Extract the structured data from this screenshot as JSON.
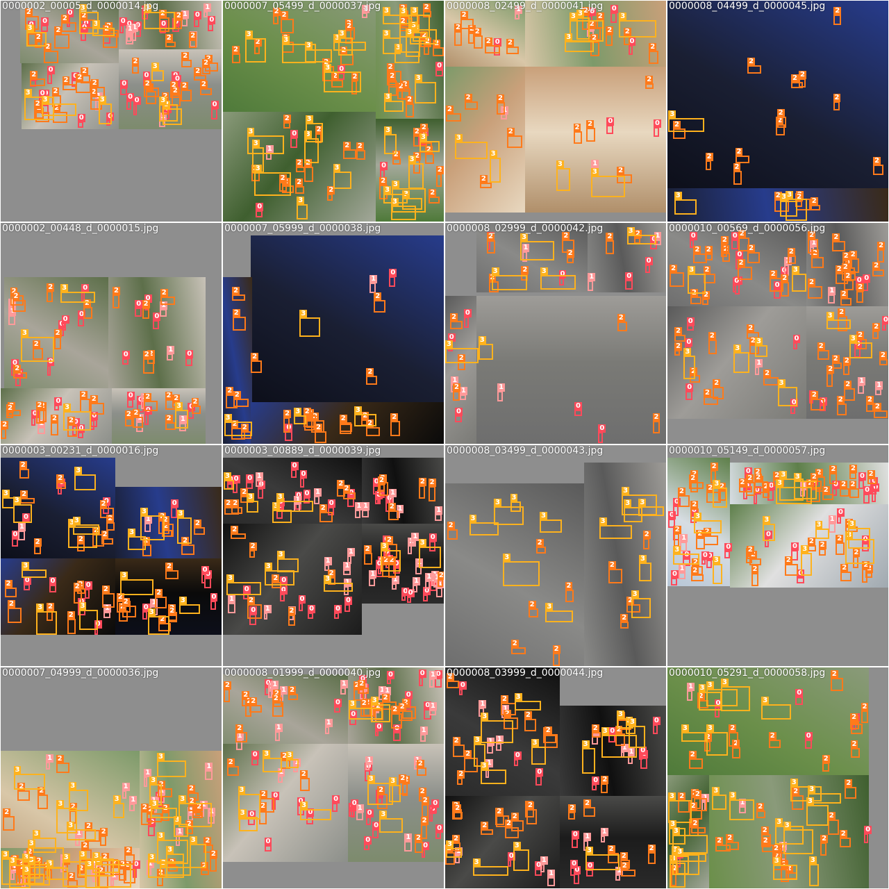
{
  "title": "",
  "class_colors": {
    "0": "#ff4a5a",
    "1": "#ff9a9a",
    "2": "#ff7a1a",
    "3": "#ffb21d"
  },
  "scene_palettes": {
    "city_day": [
      "#7d8b6d",
      "#a9a59a",
      "#5d6f4a",
      "#c8c2b8",
      "#8c8f8a"
    ],
    "green_park": [
      "#4f7a3a",
      "#6b8f4a",
      "#8a9a7a",
      "#3f5f2f",
      "#a3a89a"
    ],
    "road_grey": [
      "#6e6e6e",
      "#8a8a88",
      "#5a5a5a",
      "#9e9c98",
      "#7a7a76"
    ],
    "night": [
      "#0d0f1a",
      "#1a1f33",
      "#273c8c",
      "#3a2a18",
      "#0a0a0a"
    ],
    "warm_town": [
      "#b08f6a",
      "#d9c7a8",
      "#7d9a6a",
      "#c9a07a",
      "#e8d8c0"
    ],
    "sky_city": [
      "#b7c6d6",
      "#d7dde3",
      "#5e7f4a",
      "#e0e0e0",
      "#a0a9b0"
    ],
    "dark_road": [
      "#2a2a2a",
      "#3a3a3a",
      "#101010",
      "#4a4a48",
      "#1c1c1c"
    ]
  },
  "cells": [
    {
      "filename": "0000002_00005_d_0000014.jpg",
      "scene": "city_day",
      "counts": {
        "0": 30,
        "1": 8,
        "2": 35,
        "3": 10
      }
    },
    {
      "filename": "0000007_05499_d_0000037.jpg",
      "scene": "green_park",
      "counts": {
        "0": 8,
        "1": 2,
        "2": 45,
        "3": 30
      }
    },
    {
      "filename": "0000008_02499_d_0000041.jpg",
      "scene": "warm_town",
      "counts": {
        "0": 6,
        "1": 4,
        "2": 22,
        "3": 8
      }
    },
    {
      "filename": "0000008_04499_d_0000045.jpg",
      "scene": "night",
      "counts": {
        "0": 0,
        "1": 0,
        "2": 16,
        "3": 4
      }
    },
    {
      "filename": "0000002_00448_d_0000015.jpg",
      "scene": "city_day",
      "counts": {
        "0": 22,
        "1": 8,
        "2": 28,
        "3": 4
      }
    },
    {
      "filename": "0000007_05999_d_0000038.jpg",
      "scene": "night",
      "counts": {
        "0": 2,
        "1": 1,
        "2": 20,
        "3": 4
      }
    },
    {
      "filename": "0000008_02999_d_0000042.jpg",
      "scene": "road_grey",
      "counts": {
        "0": 10,
        "1": 6,
        "2": 12,
        "3": 6
      }
    },
    {
      "filename": "0000010_00569_d_0000056.jpg",
      "scene": "road_grey",
      "counts": {
        "0": 18,
        "1": 6,
        "2": 50,
        "3": 8
      }
    },
    {
      "filename": "0000003_00231_d_0000016.jpg",
      "scene": "night",
      "counts": {
        "0": 14,
        "1": 4,
        "2": 30,
        "3": 14
      }
    },
    {
      "filename": "0000003_00889_d_0000039.jpg",
      "scene": "dark_road",
      "counts": {
        "0": 35,
        "1": 25,
        "2": 22,
        "3": 10
      }
    },
    {
      "filename": "0000008_03499_d_0000043.jpg",
      "scene": "road_grey",
      "counts": {
        "0": 0,
        "1": 0,
        "2": 10,
        "3": 12
      }
    },
    {
      "filename": "0000010_05149_d_0000057.jpg",
      "scene": "sky_city",
      "counts": {
        "0": 25,
        "1": 4,
        "2": 40,
        "3": 12
      }
    },
    {
      "filename": "0000007_04999_d_0000036.jpg",
      "scene": "warm_town",
      "counts": {
        "0": 4,
        "1": 22,
        "2": 40,
        "3": 28
      }
    },
    {
      "filename": "0000008_01999_d_0000040.jpg",
      "scene": "city_day",
      "counts": {
        "0": 30,
        "1": 20,
        "2": 30,
        "3": 10
      }
    },
    {
      "filename": "0000008_03999_d_0000044.jpg",
      "scene": "dark_road",
      "counts": {
        "0": 14,
        "1": 14,
        "2": 30,
        "3": 14
      }
    },
    {
      "filename": "0000010_05291_d_0000058.jpg",
      "scene": "green_park",
      "counts": {
        "0": 6,
        "1": 4,
        "2": 34,
        "3": 22
      }
    }
  ]
}
